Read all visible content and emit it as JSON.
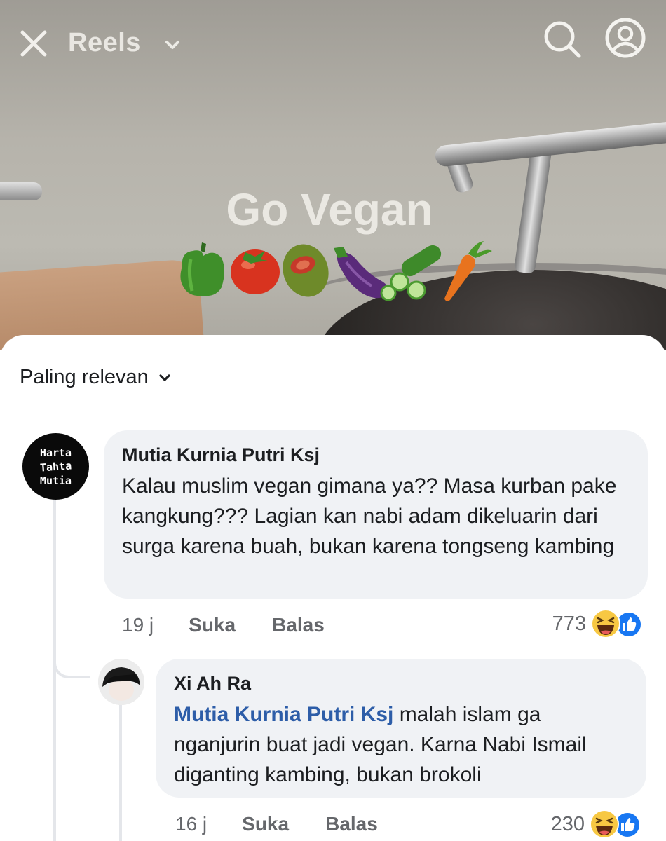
{
  "header": {
    "title": "Reels"
  },
  "video": {
    "overlay_text": "Go Vegan",
    "emojis": [
      "bell-pepper",
      "tomato",
      "olive",
      "eggplant",
      "cucumber",
      "carrot"
    ]
  },
  "comments": {
    "sort_label": "Paling relevan",
    "items": [
      {
        "author": "Mutia Kurnia Putri Ksj",
        "avatar_text": [
          "Harta",
          "Tahta",
          "Mutia"
        ],
        "text": "Kalau muslim vegan gimana ya?? Masa kurban pake kangkung??? Lagian kan nabi adam dikeluarin dari surga karena buah, bukan karena tongseng kambing",
        "time": "19 j",
        "like_label": "Suka",
        "reply_label": "Balas",
        "reaction_count": "773",
        "reactions": [
          "haha-icon",
          "like-icon"
        ]
      },
      {
        "author": "Xi Ah Ra",
        "mention": "Mutia Kurnia Putri Ksj",
        "text": " malah islam ga nganjurin buat jadi vegan. Karna Nabi Ismail diganting kambing, bukan brokoli",
        "time": "16 j",
        "like_label": "Suka",
        "reply_label": "Balas",
        "reaction_count": "230",
        "reactions": [
          "haha-icon",
          "like-icon"
        ]
      }
    ]
  },
  "colors": {
    "mention": "#2d5da8",
    "bubble": "#f0f2f5",
    "meta": "#65676b",
    "like_blue": "#1877f2",
    "haha_yellow": "#f7c843"
  }
}
